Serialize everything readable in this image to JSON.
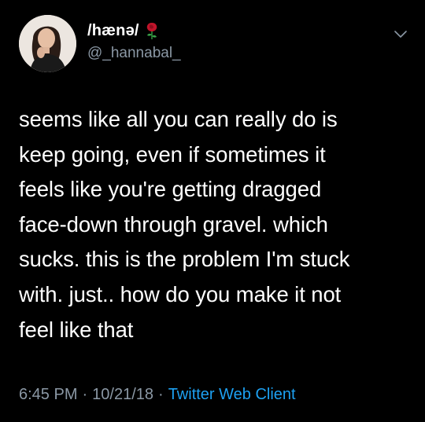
{
  "user": {
    "display_name": "/hænə/",
    "handle": "@_hannabal_",
    "avatar_icon": "user-avatar-photo",
    "emoji_icon": "rose-icon"
  },
  "menu": {
    "icon": "chevron-down-icon"
  },
  "tweet": {
    "text": "seems like all you can really do is\nkeep going, even if sometimes it\nfeels like you're getting dragged\nface-down through gravel. which\nsucks. this is the problem I'm stuck\nwith. just.. how do you make it not\nfeel like that"
  },
  "meta": {
    "time": "6:45 PM",
    "separator": "·",
    "date": "10/21/18",
    "client": "Twitter Web Client"
  },
  "colors": {
    "background": "#000000",
    "text": "#ffffff",
    "muted": "#8b98a5",
    "link": "#1da1f2"
  }
}
